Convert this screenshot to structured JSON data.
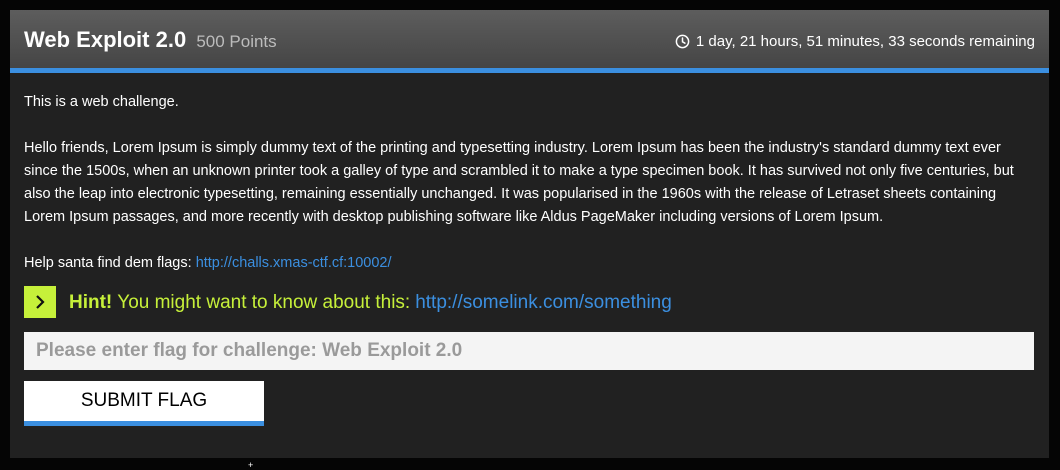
{
  "challenge": {
    "title": "Web Exploit 2.0",
    "points": "500 Points",
    "time_remaining": "1 day, 21 hours, 51 minutes, 33 seconds remaining"
  },
  "description": {
    "intro": "This is a web challenge.",
    "paragraph": "Hello friends, Lorem Ipsum is simply dummy text of the printing and typesetting industry. Lorem Ipsum has been the industry's standard dummy text ever since the 1500s, when an unknown printer took a galley of type and scrambled it to make a type specimen book. It has survived not only five centuries, but also the leap into electronic typesetting, remaining essentially unchanged. It was popularised in the 1960s with the release of Letraset sheets containing Lorem Ipsum passages, and more recently with desktop publishing software like Aldus PageMaker including versions of Lorem Ipsum.",
    "help_text": "Help santa find dem flags:",
    "help_link": "http://challs.xmas-ctf.cf:10002/"
  },
  "hint": {
    "label": "Hint!",
    "text": "You might want to know about this:",
    "link": "http://somelink.com/something"
  },
  "flag_form": {
    "placeholder": "Please enter flag for challenge: Web Exploit 2.0",
    "submit_label": "SUBMIT FLAG"
  },
  "colors": {
    "accent": "#3b8fe0",
    "hint": "#c6f03a",
    "card_bg": "#212121",
    "header_bg": "#505050"
  },
  "icons": {
    "timer": "clock-icon",
    "hint": "chevron-right-icon"
  }
}
